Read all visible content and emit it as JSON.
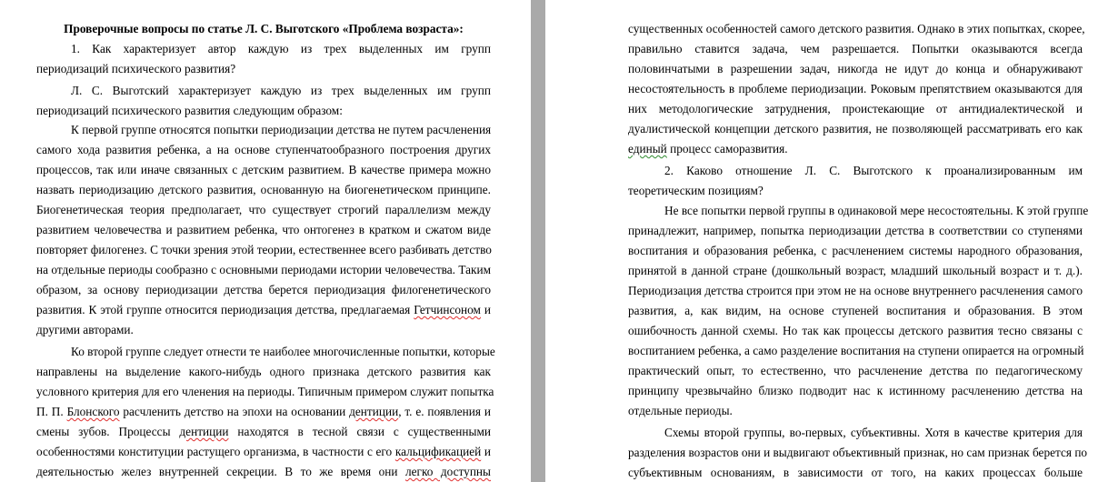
{
  "left_page": {
    "heading": "Проверочные вопросы по статье Л. С. Выготского «Проблема возраста»:",
    "lines": [
      "1.      Как характеризует автор каждую из трех выделенных им групп",
      "периодизаций психического развития?",
      "Л. С. Выготский характеризует каждую из трех выделенных им групп",
      "периодизаций психического развития следующим образом:",
      "К первой группе относятся попытки периодизации детства не путем расчленения",
      "самого хода развития ребенка, а на основе ступенчатообразного построения других",
      "процессов, так или иначе связанных с детским развитием. В качестве примера можно",
      "назвать периодизацию детского развития, основанную на биогенетическом принципе.",
      "Биогенетическая теория предполагает, что существует строгий параллелизм между",
      "развитием человечества и развитием ребенка, что онтогенез в кратком и сжатом виде",
      "повторяет филогенез. С точки зрения этой теории, естественнее всего разбивать детство",
      "на отдельные периоды сообразно с основными периодами истории человечества. Таким",
      "образом, за основу периодизации детства берется периодизация филогенетического",
      "развития. К этой группе относится периодизация детства, предлагаемая ",
      "другими авторами.",
      "Ко второй группе следует отнести те наиболее многочисленные попытки, которые",
      "направлены на выделение какого-нибудь одного признака детского развития как",
      "условного критерия для его членения на периоды. Типичным примером служит попытка",
      "П. П. ",
      "смены зубов. Процессы ",
      "особенностями конституции растущего организма, в частности с его ",
      "деятельностью желез внутренней секреции. В то же время они "
    ],
    "spell_words": {
      "getchinson": "Гетчинсоном",
      "getchinson_after": " и",
      "blonsky": "Блонского",
      "blonsky_after": " расчленить детство на эпохи на основании ",
      "denticii": "дентиции",
      "denticii_after": ", т. е. появления и",
      "denticii2": "дентиции",
      "denticii2_after": " находятся в тесной связи с существенными",
      "kalcifik": "кальцификацией",
      "kalcifik_after": " и",
      "legko": "легко доступны"
    }
  },
  "right_page": {
    "lines": [
      "существенных особенностей самого детского развития. Однако в этих попытках, скорее,",
      "правильно ставится задача, чем разрешается. Попытки оказываются всегда",
      "половинчатыми в разрешении задач, никогда не идут до конца и обнаруживают",
      "несостоятельность в проблеме периодизации. Роковым препятствием оказываются для",
      "них методологические затруднения, проистекающие от антидиалектической и",
      "дуалистической концепции детского развития, не позволяющей рассматривать его как",
      " процесс саморазвития.",
      "2.      Каково отношение Л. С. Выготского к проанализированным им",
      "теоретическим позициям?",
      "Не все попытки первой группы в одинаковой мере несостоятельны. К этой группе",
      "принадлежит, например, попытка периодизации детства в соответствии со ступенями",
      "воспитания и образования ребенка, с расчленением системы народного образования,",
      "принятой в данной стране (дошкольный возраст, младший школьный возраст и т. д.).",
      "Периодизация детства строится при этом не на основе внутреннего расчленения самого",
      "развития, а, как видим, на основе ступеней воспитания и образования. В этом",
      "ошибочность данной схемы. Но так как процессы детского развития тесно связаны с",
      "воспитанием ребенка, а само разделение воспитания на ступени опирается на огромный",
      "практический опыт, то естественно, что расчленение детства по педагогическому",
      "принципу чрезвычайно близко подводит нас к истинному расчленению детства на",
      "отдельные периоды.",
      "Схемы второй группы, во-первых, субъективны. Хотя в качестве критерия для",
      "разделения возрастов они и выдвигают объективный признак, но сам признак берется по",
      "субъективным основаниям, в зависимости от того, на каких процессах больше"
    ],
    "grammar_word": "единый"
  }
}
